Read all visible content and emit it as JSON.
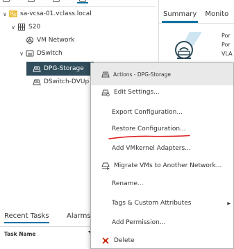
{
  "tree": {
    "items": [
      {
        "label": "sa-vcsa-01.vclass.local",
        "icon": "vcenter-icon",
        "expanded": true
      },
      {
        "label": "S20",
        "icon": "datacenter-icon",
        "expanded": true
      },
      {
        "label": "VM Network",
        "icon": "network-icon"
      },
      {
        "label": "DSwitch",
        "icon": "dswitch-icon",
        "expanded": true
      },
      {
        "label": "DPG-Storage",
        "icon": "portgroup-icon",
        "selected": true
      },
      {
        "label": "DSwitch-DVUp",
        "icon": "portgroup-icon"
      }
    ]
  },
  "right_panel": {
    "tabs": [
      "Summary",
      "Monito"
    ],
    "active_tab": "Summary",
    "summary_lines": [
      "Por",
      "Por",
      "VLA"
    ]
  },
  "bottom_panel": {
    "tabs": [
      "Recent Tasks",
      "Alarms"
    ],
    "active_tab": "Recent Tasks",
    "column_header": "Task Name"
  },
  "context_menu": {
    "header": "Actions - DPG-Storage",
    "items": [
      {
        "label": "Edit Settings...",
        "icon": "edit-settings-icon"
      },
      {
        "label": "Export Configuration...",
        "icon": ""
      },
      {
        "label": "Restore Configuration...",
        "icon": ""
      },
      {
        "label": "Add VMkernel Adapters...",
        "icon": "",
        "annotated": true
      },
      {
        "label": "Migrate VMs to Another Network...",
        "icon": "migrate-icon"
      },
      {
        "label": "Rename...",
        "icon": ""
      },
      {
        "label": "Tags & Custom Attributes",
        "icon": "",
        "submenu": true
      },
      {
        "label": "Add Permission...",
        "icon": ""
      },
      {
        "label": "Delete",
        "icon": "delete-icon"
      }
    ]
  },
  "colors": {
    "selected_bg": "#314e5c",
    "accent": "#0072a3",
    "vcenter_icon": "#e6a800",
    "delete_icon": "#c92100",
    "annotation": "#e02020"
  }
}
